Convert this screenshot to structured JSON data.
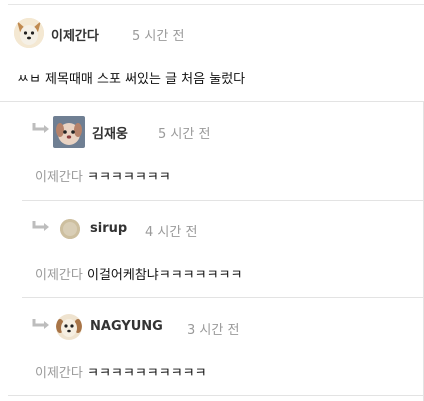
{
  "post": {
    "author": "이제간다",
    "time": "5 시간 전",
    "text": "ㅆㅂ 제목때매 스포 써있는 글 처음 눌렀다"
  },
  "replies": [
    {
      "author": "김재웅",
      "time": "5 시간 전",
      "mention": "이제간다",
      "text": "ㅋㅋㅋㅋㅋㅋㅋ"
    },
    {
      "author": "sirup",
      "time": "4 시간 전",
      "mention": "이제간다",
      "text": "이걸어케참냐ㅋㅋㅋㅋㅋㅋㅋ"
    },
    {
      "author": "NAGYUNG",
      "time": "3 시간 전",
      "mention": "이제간다",
      "text": "ㅋㅋㅋㅋㅋㅋㅋㅋㅋㅋ"
    }
  ]
}
